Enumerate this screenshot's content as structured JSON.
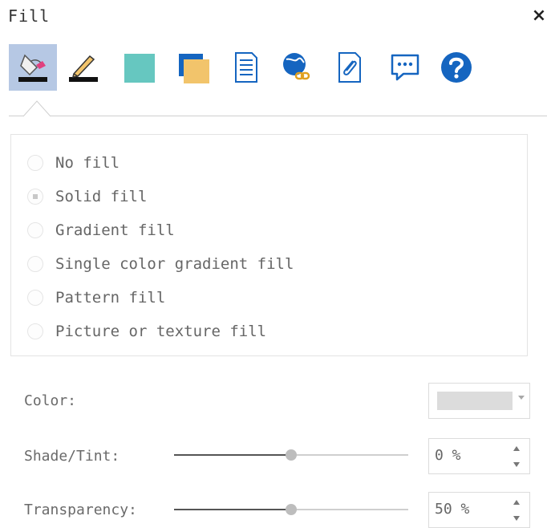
{
  "panel": {
    "title": "Fill",
    "close_glyph": "×"
  },
  "toolbar": {
    "icons": [
      "fill-bucket-icon",
      "line-pen-icon",
      "fill-color-swatch-icon",
      "shadow-icon",
      "data-document-icon",
      "hyperlink-globe-icon",
      "attachment-icon",
      "comment-icon",
      "help-icon"
    ],
    "active_index": 0
  },
  "fill_options": [
    {
      "label": "No fill",
      "selected": false
    },
    {
      "label": "Solid fill",
      "selected": true
    },
    {
      "label": "Gradient fill",
      "selected": false
    },
    {
      "label": "Single color gradient fill",
      "selected": false
    },
    {
      "label": "Pattern fill",
      "selected": false
    },
    {
      "label": "Picture or texture fill",
      "selected": false
    }
  ],
  "color": {
    "label": "Color:",
    "swatch": "#dcdcdc"
  },
  "shade_tint": {
    "label": "Shade/Tint:",
    "value_text": "0 %",
    "slider_fraction": 0.5
  },
  "transparency": {
    "label": "Transparency:",
    "value_text": "50 %",
    "slider_fraction": 0.5
  },
  "colors": {
    "active_tab": "#b6c8e4",
    "teal": "#66c7c0",
    "blue": "#1565c0",
    "gold": "#f2c46b",
    "pink": "#e0417f"
  }
}
